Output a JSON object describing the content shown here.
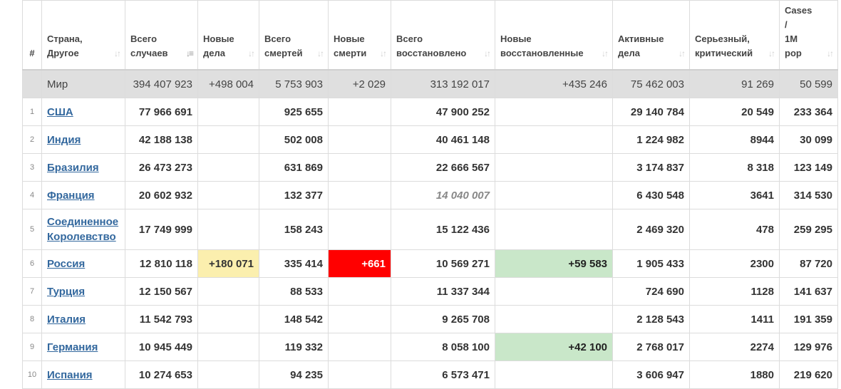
{
  "headers": {
    "num": "#",
    "country": [
      "Страна,",
      "Другое"
    ],
    "total_cases": [
      "Всего",
      "случаев"
    ],
    "new_cases": [
      "Новые",
      "дела"
    ],
    "total_deaths": [
      "Всего",
      "смертей"
    ],
    "new_deaths": [
      "Новые",
      "смерти"
    ],
    "total_recovered": [
      "Всего",
      "восстановлено"
    ],
    "new_recovered": [
      "Новые",
      "восстановленные"
    ],
    "active": [
      "Активные",
      "дела"
    ],
    "serious": [
      "Серьезный,",
      "критический"
    ],
    "per_million": [
      "Cases",
      "/",
      "1M",
      "pop"
    ]
  },
  "world": {
    "country": "Мир",
    "total_cases": "394 407 923",
    "new_cases": "+498 004",
    "total_deaths": "5 753 903",
    "new_deaths": "+2 029",
    "total_recovered": "313 192 017",
    "new_recovered": "+435 246",
    "active": "75 462 003",
    "serious": "91 269",
    "per_million": "50 599"
  },
  "rows": [
    {
      "num": "1",
      "country": "США",
      "total_cases": "77 966 691",
      "new_cases": "",
      "total_deaths": "925 655",
      "new_deaths": "",
      "total_recovered": "47 900 252",
      "new_recovered": "",
      "active": "29 140 784",
      "serious": "20 549",
      "per_million": "233 364"
    },
    {
      "num": "2",
      "country": "Индия",
      "total_cases": "42 188 138",
      "new_cases": "",
      "total_deaths": "502 008",
      "new_deaths": "",
      "total_recovered": "40 461 148",
      "new_recovered": "",
      "active": "1 224 982",
      "serious": "8944",
      "per_million": "30 099"
    },
    {
      "num": "3",
      "country": "Бразилия",
      "total_cases": "26 473 273",
      "new_cases": "",
      "total_deaths": "631 869",
      "new_deaths": "",
      "total_recovered": "22 666 567",
      "new_recovered": "",
      "active": "3 174 837",
      "serious": "8 318",
      "per_million": "123 149"
    },
    {
      "num": "4",
      "country": "Франция",
      "total_cases": "20 602 932",
      "new_cases": "",
      "total_deaths": "132 377",
      "new_deaths": "",
      "total_recovered": "14 040 007",
      "new_recovered": "",
      "active": "6 430 548",
      "serious": "3641",
      "per_million": "314 530"
    },
    {
      "num": "5",
      "country": "Соединенное Королевство",
      "total_cases": "17 749 999",
      "new_cases": "",
      "total_deaths": "158 243",
      "new_deaths": "",
      "total_recovered": "15 122 436",
      "new_recovered": "",
      "active": "2 469 320",
      "serious": "478",
      "per_million": "259 295"
    },
    {
      "num": "6",
      "country": "Россия",
      "total_cases": "12 810 118",
      "new_cases": "+180 071",
      "total_deaths": "335 414",
      "new_deaths": "+661",
      "total_recovered": "10 569 271",
      "new_recovered": "+59 583",
      "active": "1 905 433",
      "serious": "2300",
      "per_million": "87 720"
    },
    {
      "num": "7",
      "country": "Турция",
      "total_cases": "12 150 567",
      "new_cases": "",
      "total_deaths": "88 533",
      "new_deaths": "",
      "total_recovered": "11 337 344",
      "new_recovered": "",
      "active": "724 690",
      "serious": "1128",
      "per_million": "141 637"
    },
    {
      "num": "8",
      "country": "Италия",
      "total_cases": "11 542 793",
      "new_cases": "",
      "total_deaths": "148 542",
      "new_deaths": "",
      "total_recovered": "9 265 708",
      "new_recovered": "",
      "active": "2 128 543",
      "serious": "1411",
      "per_million": "191 359"
    },
    {
      "num": "9",
      "country": "Германия",
      "total_cases": "10 945 449",
      "new_cases": "",
      "total_deaths": "119 332",
      "new_deaths": "",
      "total_recovered": "8 058 100",
      "new_recovered": "+42 100",
      "active": "2 768 017",
      "serious": "2274",
      "per_million": "129 976"
    },
    {
      "num": "10",
      "country": "Испания",
      "total_cases": "10 274 653",
      "new_cases": "",
      "total_deaths": "94 235",
      "new_deaths": "",
      "total_recovered": "6 573 471",
      "new_recovered": "",
      "active": "3 606 947",
      "serious": "1880",
      "per_million": "219 620"
    }
  ],
  "sort_icons": {
    "inactive": "sort-arrows-icon",
    "active": "sort-desc-icon"
  },
  "colors": {
    "new_cases_bg": "#fbefae",
    "new_deaths_bg": "#ff0000",
    "new_recovered_bg": "#c9e7c9",
    "link": "#33689e",
    "world_bg": "#dfdfdf"
  }
}
